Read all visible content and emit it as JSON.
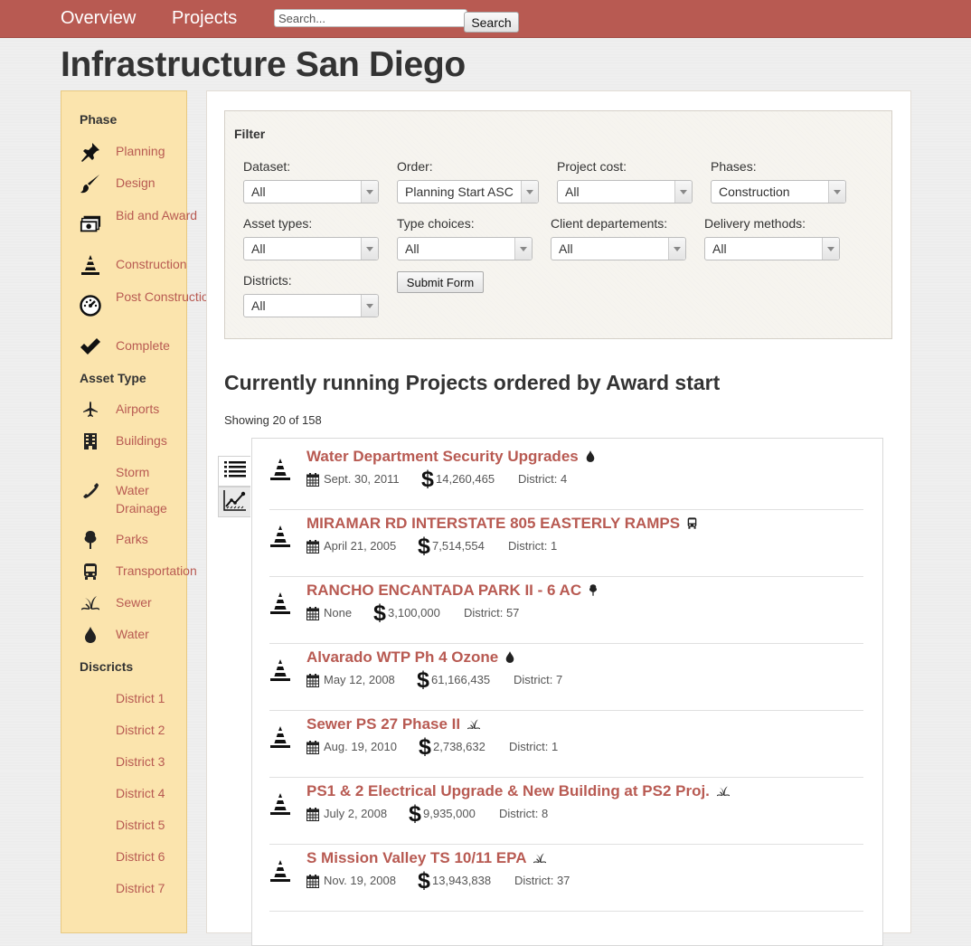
{
  "nav": {
    "overview": "Overview",
    "projects": "Projects",
    "search_placeholder": "Search...",
    "search_button": "Search"
  },
  "title": "Infrastructure San Diego",
  "sidebar": {
    "phase_heading": "Phase",
    "phases": [
      {
        "label": "Planning",
        "icon": "pushpin-icon"
      },
      {
        "label": "Design",
        "icon": "paintbrush-icon"
      },
      {
        "label": "Bid and Award",
        "icon": "money-icon"
      },
      {
        "label": "Construction",
        "icon": "traffic-cone-icon"
      },
      {
        "label": "Post Construction",
        "icon": "dashboard-gauge-icon"
      },
      {
        "label": "Complete",
        "icon": "checkmark-icon"
      }
    ],
    "asset_heading": "Asset Type",
    "assets": [
      {
        "label": "Airports",
        "icon": "airplane-icon"
      },
      {
        "label": "Buildings",
        "icon": "building-icon"
      },
      {
        "label": "Storm Water Drainage",
        "icon": "phone-icon"
      },
      {
        "label": "Parks",
        "icon": "tree-icon"
      },
      {
        "label": "Transportation",
        "icon": "bus-icon"
      },
      {
        "label": "Sewer",
        "icon": "sewer-plant-icon"
      },
      {
        "label": "Water",
        "icon": "water-drop-icon"
      }
    ],
    "district_heading": "Discricts",
    "districts": [
      "District 1",
      "District 2",
      "District 3",
      "District 4",
      "District 5",
      "District 6",
      "District 7"
    ]
  },
  "filter": {
    "title": "Filter",
    "dataset": {
      "label": "Dataset:",
      "value": "All"
    },
    "order": {
      "label": "Order:",
      "value": "Planning Start ASC"
    },
    "project_cost": {
      "label": "Project cost:",
      "value": "All"
    },
    "phases": {
      "label": "Phases:",
      "value": "Construction"
    },
    "asset_types": {
      "label": "Asset types:",
      "value": "All"
    },
    "type_choices": {
      "label": "Type choices:",
      "value": "All"
    },
    "client_departements": {
      "label": "Client departements:",
      "value": "All"
    },
    "delivery_methods": {
      "label": "Delivery methods:",
      "value": "All"
    },
    "districts": {
      "label": "Districts:",
      "value": "All"
    },
    "submit": "Submit Form"
  },
  "list": {
    "title": "Currently running Projects ordered by Award start",
    "showing": "Showing 20 of 158",
    "projects": [
      {
        "title": "Water Department Security Upgrades",
        "type_icon": "water-drop-icon",
        "date": "Sept. 30, 2011",
        "cost": "14,260,465",
        "district": "District: 4"
      },
      {
        "title": "MIRAMAR RD INTERSTATE 805 EASTERLY RAMPS",
        "type_icon": "bus-icon",
        "date": "April 21, 2005",
        "cost": "7,514,554",
        "district": "District: 1"
      },
      {
        "title": "RANCHO ENCANTADA PARK II - 6 AC",
        "type_icon": "tree-icon",
        "date": "None",
        "cost": "3,100,000",
        "district": "District: 57"
      },
      {
        "title": "Alvarado WTP Ph 4 Ozone",
        "type_icon": "water-drop-icon",
        "date": "May 12, 2008",
        "cost": "61,166,435",
        "district": "District: 7"
      },
      {
        "title": "Sewer PS 27 Phase II",
        "type_icon": "sewer-plant-icon",
        "date": "Aug. 19, 2010",
        "cost": "2,738,632",
        "district": "District: 1"
      },
      {
        "title": "PS1 & 2 Electrical Upgrade & New Building at PS2 Proj.",
        "type_icon": "sewer-plant-icon",
        "date": "July 2, 2008",
        "cost": "9,935,000",
        "district": "District: 8"
      },
      {
        "title": "S Mission Valley TS 10/11 EPA",
        "type_icon": "sewer-plant-icon",
        "date": "Nov. 19, 2008",
        "cost": "13,943,838",
        "district": "District: 37"
      }
    ],
    "dollar_sign": "$"
  },
  "colors": {
    "accent": "#b85a52",
    "sidebar_bg": "#fbe4ad"
  }
}
